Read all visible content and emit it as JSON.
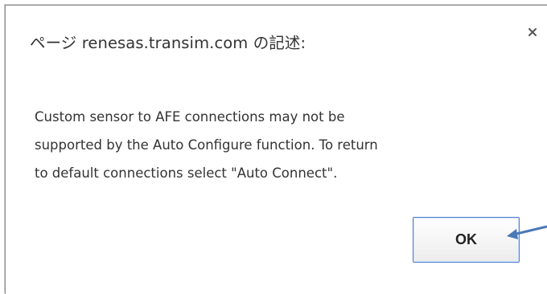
{
  "dialog": {
    "title": "ページ renesas.transim.com の記述:",
    "message": "Custom sensor to AFE connections may not be\nsupported by the Auto Configure function.  To return\nto default connections select \"Auto Connect\".",
    "ok_label": "OK",
    "close_icon": "close-icon"
  },
  "colors": {
    "button_border": "#4f7fcf",
    "arrow": "#4a78b8",
    "text": "#333333"
  }
}
